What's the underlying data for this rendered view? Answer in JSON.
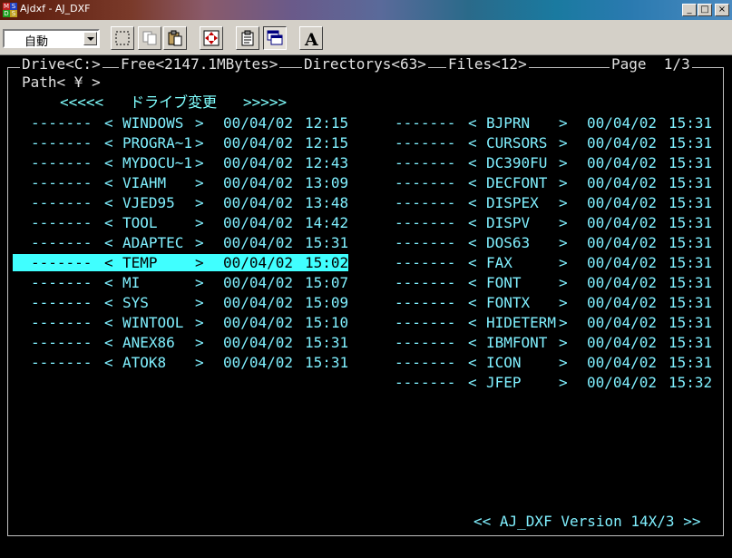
{
  "window": {
    "title": "Ajdxf - AJ_DXF",
    "icon_letters": [
      "M",
      "S",
      "D",
      "S"
    ],
    "minimize": "_",
    "maximize": "□",
    "close": "×"
  },
  "toolbar": {
    "combo_value": "自動",
    "buttons": [
      "select-icon",
      "copy-icon",
      "paste-icon",
      "move-icon",
      "properties-icon",
      "window-icon",
      "font-icon"
    ],
    "font_letter": "A"
  },
  "header": {
    "drive": "Drive<C:>",
    "free": "Free<2147.1MBytes>",
    "directorys": "Directorys<63>",
    "files": "Files<12>",
    "page": "Page  1/3"
  },
  "path": "Path< ¥ >",
  "drive_change": "<<<<<   ドライブ変更   >>>>>",
  "left_column": [
    {
      "dash": "-------",
      "open": "<",
      "name": "WINDOWS",
      "close": ">",
      "date": "00/04/02",
      "time": "12:15"
    },
    {
      "dash": "-------",
      "open": "<",
      "name": "PROGRA~1",
      "close": ">",
      "date": "00/04/02",
      "time": "12:15"
    },
    {
      "dash": "-------",
      "open": "<",
      "name": "MYDOCU~1",
      "close": ">",
      "date": "00/04/02",
      "time": "12:43"
    },
    {
      "dash": "-------",
      "open": "<",
      "name": "VIAHM",
      "close": ">",
      "date": "00/04/02",
      "time": "13:09"
    },
    {
      "dash": "-------",
      "open": "<",
      "name": "VJED95",
      "close": ">",
      "date": "00/04/02",
      "time": "13:48"
    },
    {
      "dash": "-------",
      "open": "<",
      "name": "TOOL",
      "close": ">",
      "date": "00/04/02",
      "time": "14:42"
    },
    {
      "dash": "-------",
      "open": "<",
      "name": "ADAPTEC",
      "close": ">",
      "date": "00/04/02",
      "time": "15:31"
    },
    {
      "dash": "-------",
      "open": "<",
      "name": "TEMP",
      "close": ">",
      "date": "00/04/02",
      "time": "15:02"
    },
    {
      "dash": "-------",
      "open": "<",
      "name": "MI",
      "close": ">",
      "date": "00/04/02",
      "time": "15:07"
    },
    {
      "dash": "-------",
      "open": "<",
      "name": "SYS",
      "close": ">",
      "date": "00/04/02",
      "time": "15:09"
    },
    {
      "dash": "-------",
      "open": "<",
      "name": "WINTOOL",
      "close": ">",
      "date": "00/04/02",
      "time": "15:10"
    },
    {
      "dash": "-------",
      "open": "<",
      "name": "ANEX86",
      "close": ">",
      "date": "00/04/02",
      "time": "15:31"
    },
    {
      "dash": "-------",
      "open": "<",
      "name": "ATOK8",
      "close": ">",
      "date": "00/04/02",
      "time": "15:31"
    }
  ],
  "right_column": [
    {
      "dash": "-------",
      "open": "<",
      "name": "BJPRN",
      "close": ">",
      "date": "00/04/02",
      "time": "15:31"
    },
    {
      "dash": "-------",
      "open": "<",
      "name": "CURSORS",
      "close": ">",
      "date": "00/04/02",
      "time": "15:31"
    },
    {
      "dash": "-------",
      "open": "<",
      "name": "DC390FU",
      "close": ">",
      "date": "00/04/02",
      "time": "15:31"
    },
    {
      "dash": "-------",
      "open": "<",
      "name": "DECFONT",
      "close": ">",
      "date": "00/04/02",
      "time": "15:31"
    },
    {
      "dash": "-------",
      "open": "<",
      "name": "DISPEX",
      "close": ">",
      "date": "00/04/02",
      "time": "15:31"
    },
    {
      "dash": "-------",
      "open": "<",
      "name": "DISPV",
      "close": ">",
      "date": "00/04/02",
      "time": "15:31"
    },
    {
      "dash": "-------",
      "open": "<",
      "name": "DOS63",
      "close": ">",
      "date": "00/04/02",
      "time": "15:31"
    },
    {
      "dash": "-------",
      "open": "<",
      "name": "FAX",
      "close": ">",
      "date": "00/04/02",
      "time": "15:31"
    },
    {
      "dash": "-------",
      "open": "<",
      "name": "FONT",
      "close": ">",
      "date": "00/04/02",
      "time": "15:31"
    },
    {
      "dash": "-------",
      "open": "<",
      "name": "FONTX",
      "close": ">",
      "date": "00/04/02",
      "time": "15:31"
    },
    {
      "dash": "-------",
      "open": "<",
      "name": "HIDETERM",
      "close": ">",
      "date": "00/04/02",
      "time": "15:31"
    },
    {
      "dash": "-------",
      "open": "<",
      "name": "IBMFONT",
      "close": ">",
      "date": "00/04/02",
      "time": "15:31"
    },
    {
      "dash": "-------",
      "open": "<",
      "name": "ICON",
      "close": ">",
      "date": "00/04/02",
      "time": "15:31"
    },
    {
      "dash": "-------",
      "open": "<",
      "name": "JFEP",
      "close": ">",
      "date": "00/04/02",
      "time": "15:32"
    }
  ],
  "selected_index": 7,
  "footer": "<< AJ_DXF Version 14X/3 >>",
  "colors": {
    "text": "#80f0ff",
    "selection": "#40ffff",
    "background": "#000000"
  }
}
